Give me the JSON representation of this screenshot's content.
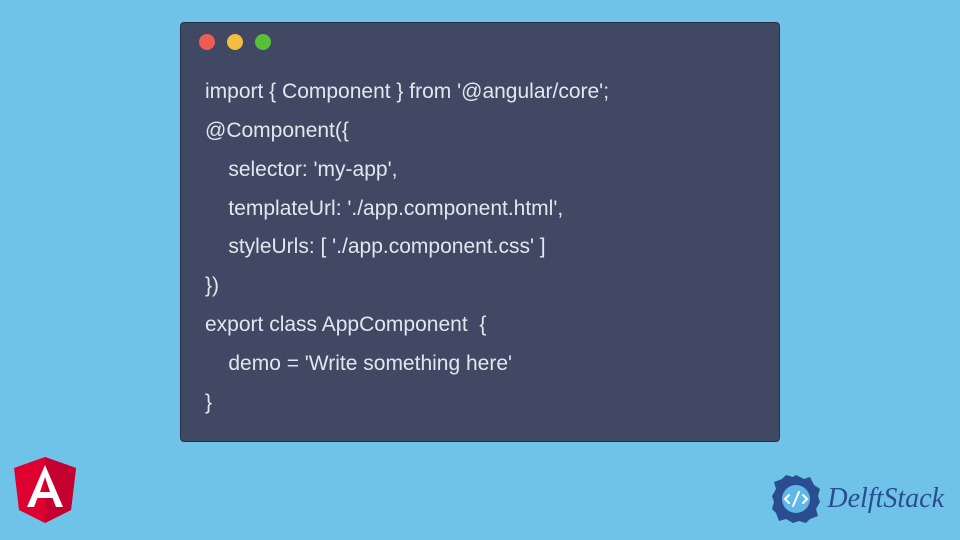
{
  "code": {
    "line1": "import { Component } from '@angular/core';",
    "line2": "@Component({",
    "line3": "    selector: 'my-app',",
    "line4": "    templateUrl: './app.component.html',",
    "line5": "    styleUrls: [ './app.component.css' ]",
    "line6": "})",
    "line7": "export class AppComponent  {",
    "line8": "    demo = 'Write something here'",
    "line9": "}"
  },
  "branding": {
    "delftstack": "DelftStack"
  }
}
